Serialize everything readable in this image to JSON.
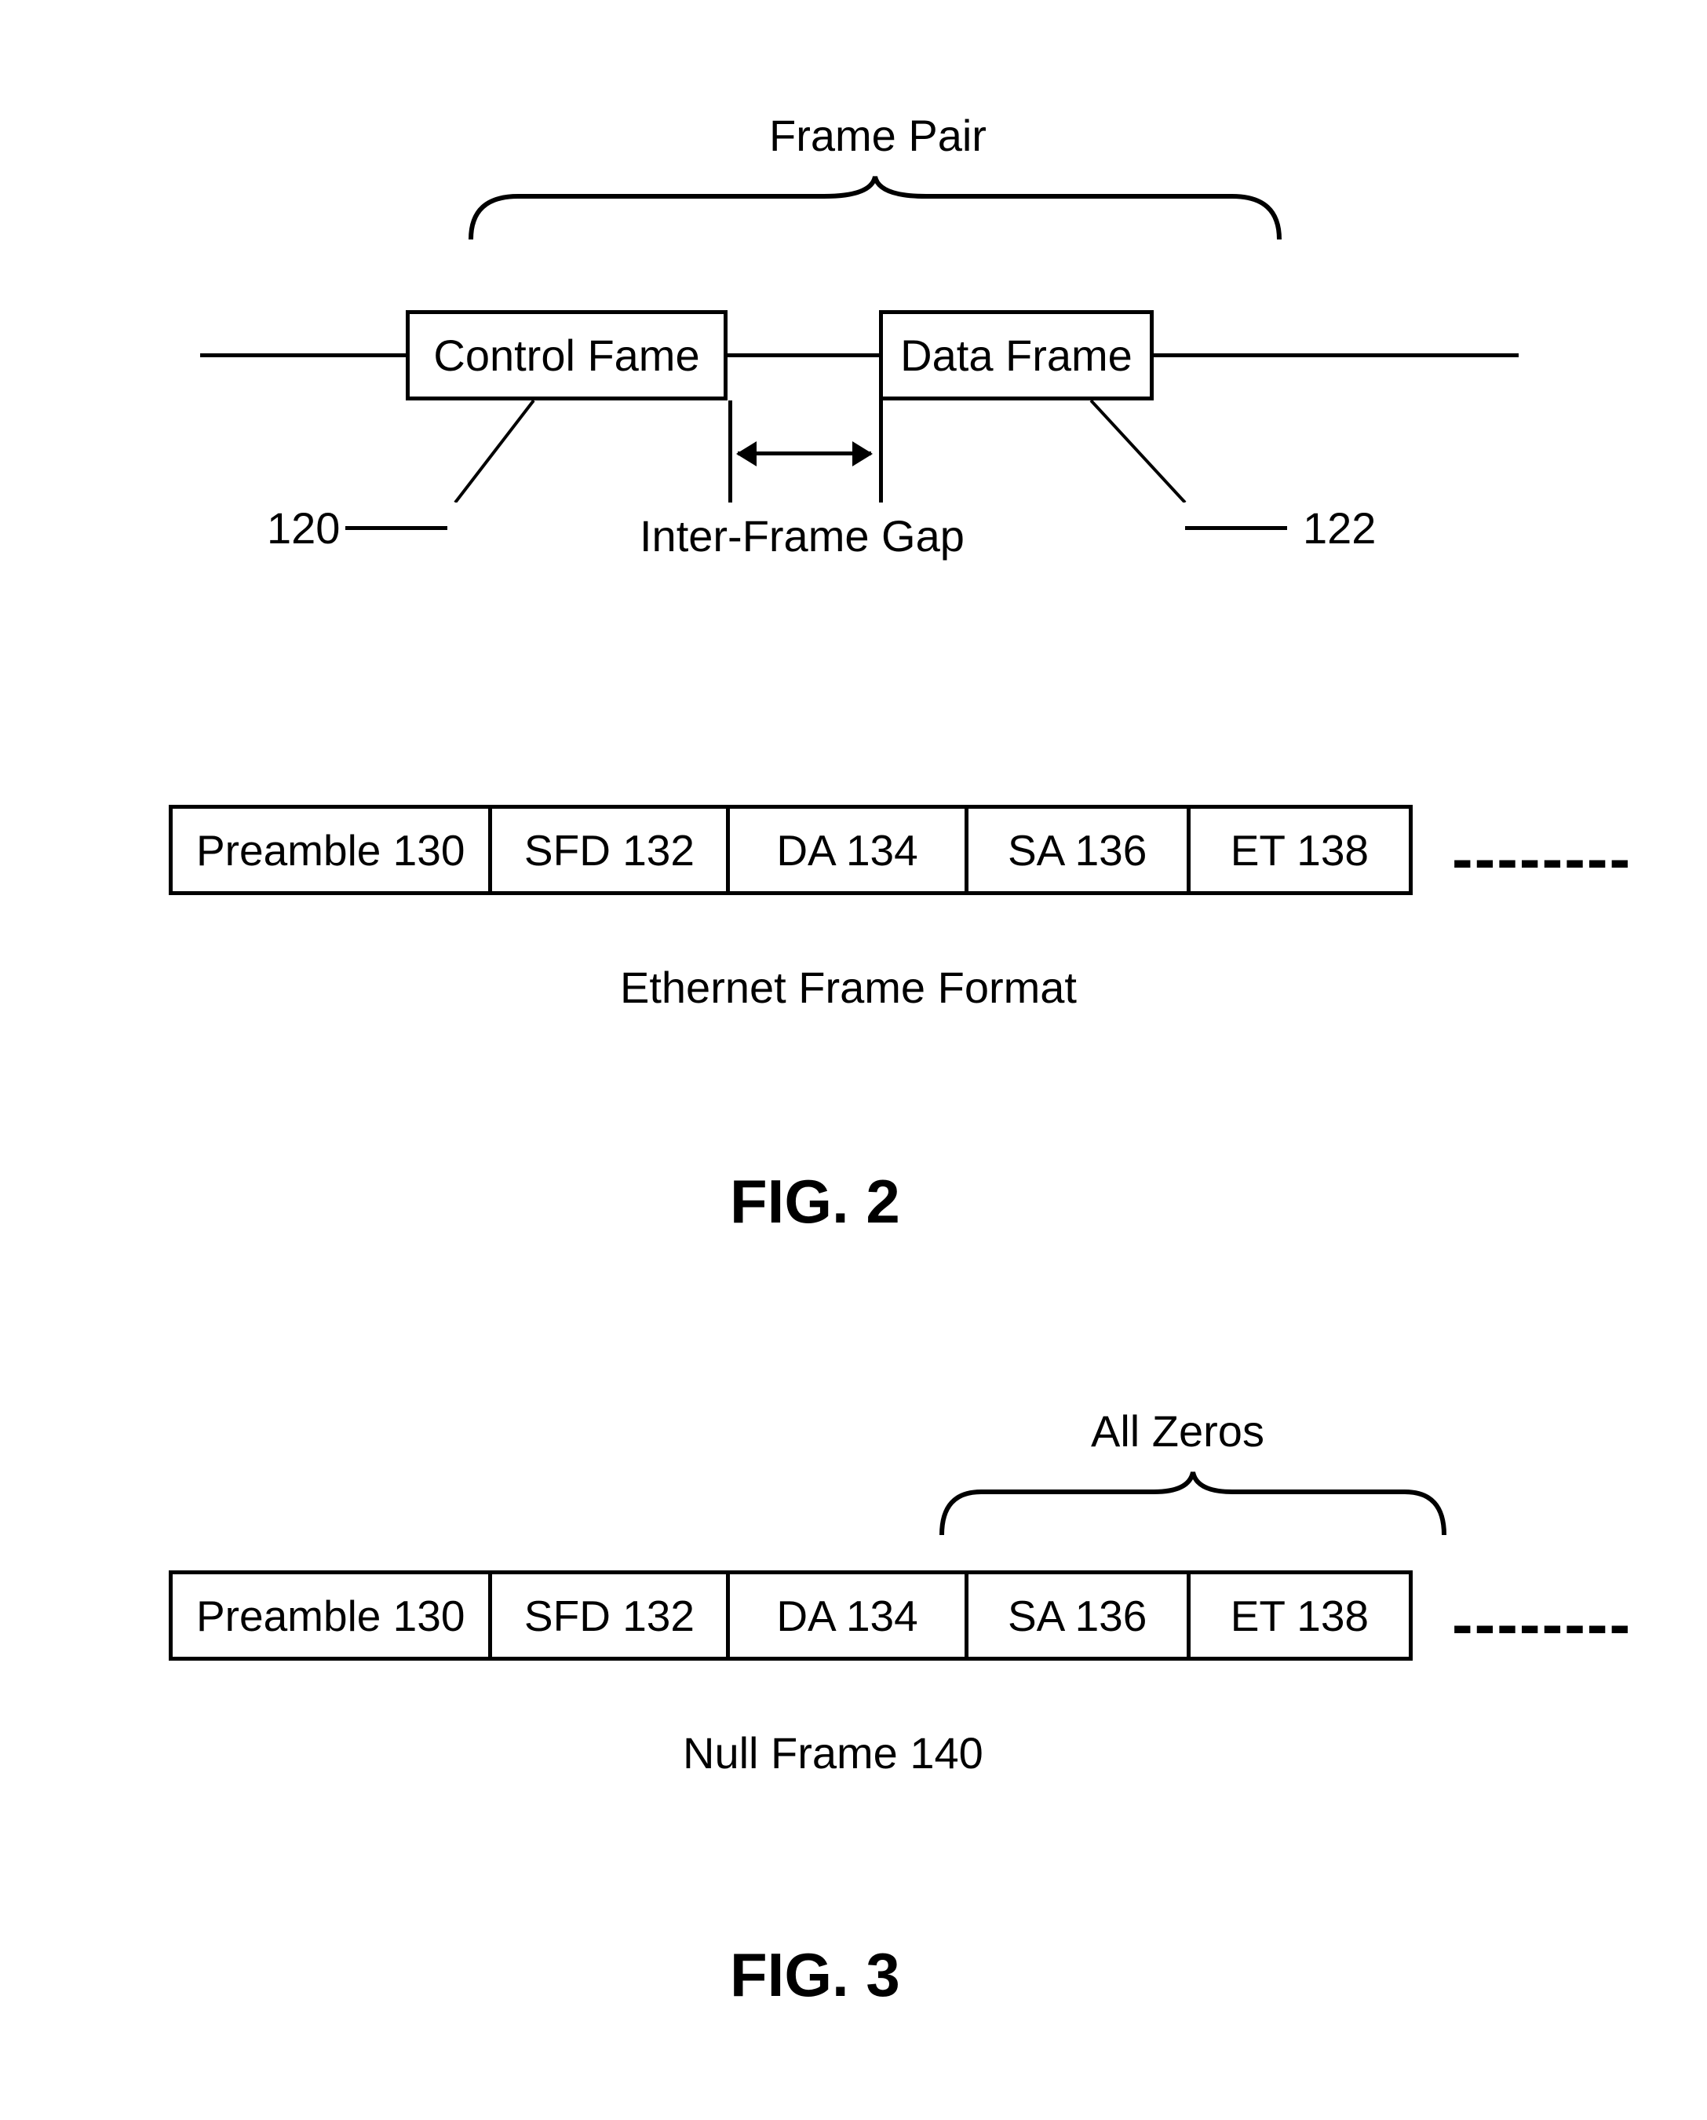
{
  "fig2": {
    "pair_label": "Frame Pair",
    "control_frame": "Control Fame",
    "data_frame": "Data Frame",
    "control_ref": "120",
    "data_ref": "122",
    "ifg": "Inter-Frame Gap",
    "caption": "Ethernet Frame Format",
    "title": "FIG. 2",
    "fields": {
      "preamble": "Preamble 130",
      "sfd": "SFD  132",
      "da": "DA  134",
      "sa": "SA  136",
      "et": "ET  138"
    }
  },
  "fig3": {
    "allzeros": "All Zeros",
    "caption": "Null Frame 140",
    "title": "FIG. 3",
    "fields": {
      "preamble": "Preamble 130",
      "sfd": "SFD  132",
      "da": "DA  134",
      "sa": "SA  136",
      "et": "ET  138"
    }
  }
}
